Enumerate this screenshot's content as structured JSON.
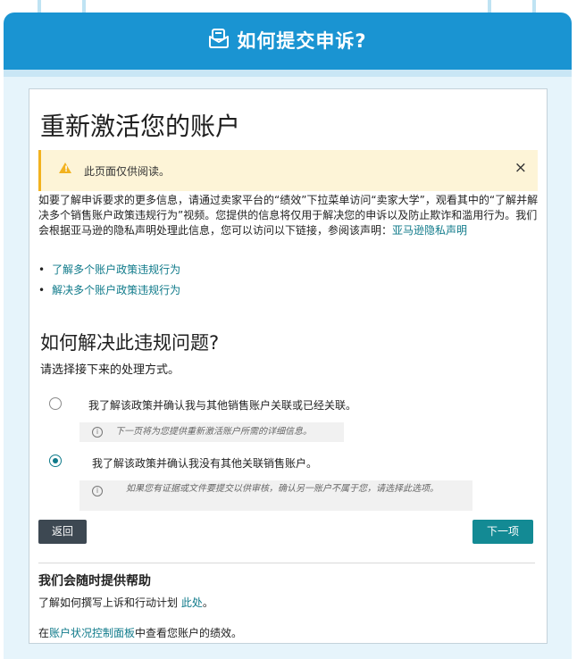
{
  "banner": {
    "icon": "document-envelope-icon",
    "title": "如何提交申诉?"
  },
  "page": {
    "title": "重新激活您的账户",
    "alert": {
      "icon": "warning-icon",
      "text": "此页面仅供阅读。",
      "close_label": "×"
    },
    "intro": {
      "text": "如要了解申诉要求的更多信息，请通过卖家平台的“绩效”下拉菜单访问“卖家大学”，观看其中的“了解并解决多个销售账户政策违规行为”视频。您提供的信息将仅用于解决您的申诉以及防止欺诈和滥用行为。我们会根据亚马逊的隐私声明处理此信息，您可以访问以下链接，参阅该声明：",
      "link": "亚马逊隐私声明"
    },
    "bullets": [
      {
        "marker": "•",
        "label": "了解多个账户政策违规行为"
      },
      {
        "marker": "•",
        "label": "解决多个账户政策违规行为"
      }
    ],
    "question": {
      "title": "如何解决此违规问题?",
      "subtitle": "请选择接下来的处理方式。"
    },
    "options": [
      {
        "label": "我了解该政策并确认我与其他销售账户关联或已经关联。",
        "selected": false,
        "hint": "下一页将为您提供重新激活账户所需的详细信息。"
      },
      {
        "label": "我了解该政策并确认我没有其他关联销售账户。",
        "selected": true,
        "hint": "如果您有证据或文件要提交以供审核，确认另一账户不属于您，请选择此选项。"
      }
    ],
    "buttons": {
      "back": "返回",
      "next": "下一项"
    },
    "help": {
      "title": "我们会随时提供帮助",
      "line1_text": "了解如何撰写上诉和行动计划 ",
      "line1_link": "此处",
      "line1_end": "。",
      "line2_prefix": "在",
      "line2_link": "账户状况控制面板",
      "line2_suffix": "中查看您账户的绩效。"
    }
  },
  "colors": {
    "banner": "#1a94d2",
    "link": "#0f7a8a",
    "next_button": "#138a94",
    "back_button": "#3d4852",
    "alert_bg": "#fdf4d7",
    "alert_accent": "#f2b21f"
  }
}
